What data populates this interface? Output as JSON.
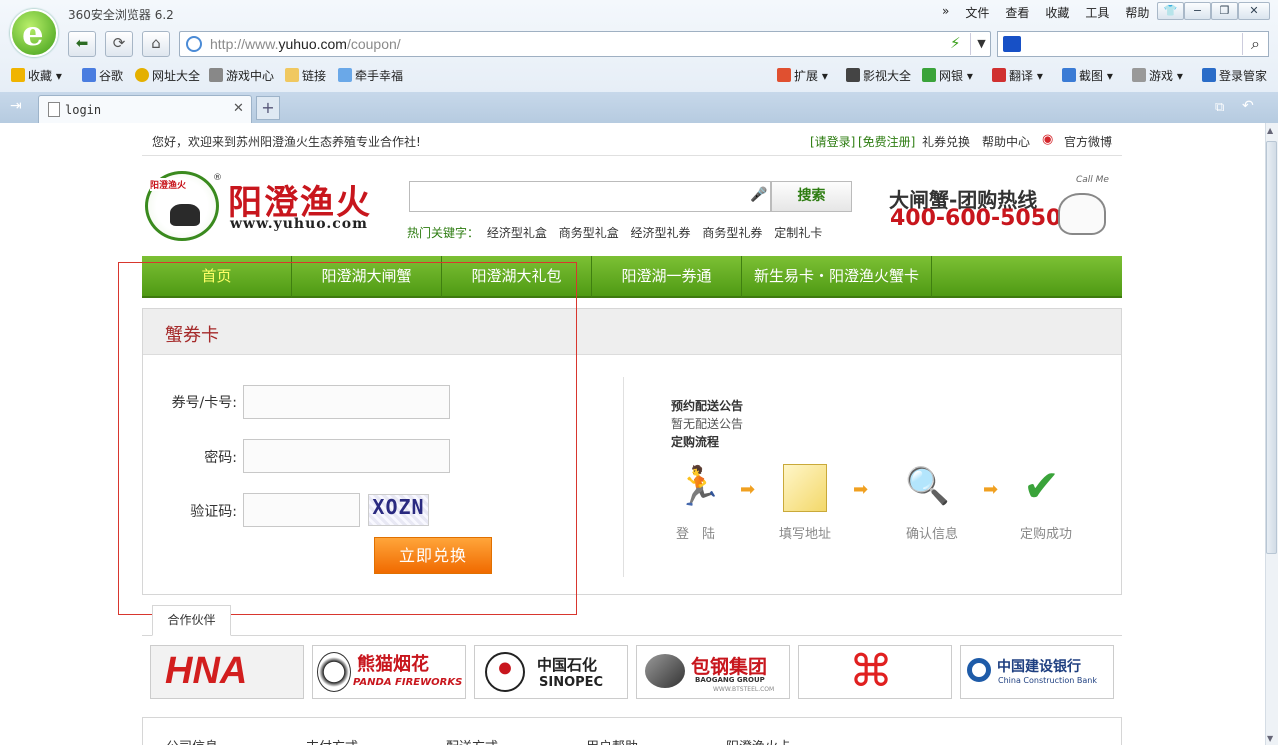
{
  "browser": {
    "title": "360安全浏览器 6.2",
    "menus": [
      "文件",
      "查看",
      "收藏",
      "工具",
      "帮助"
    ],
    "url_prefix": "http://www.",
    "url_domain": "yuhuo.com",
    "url_suffix": "/coupon/",
    "bookmarks": [
      {
        "label": "收藏",
        "icon": "star-icon"
      },
      {
        "label": "谷歌",
        "icon": "google-icon"
      },
      {
        "label": "网址大全",
        "icon": "globe-icon"
      },
      {
        "label": "游戏中心",
        "icon": "gamepad-icon"
      },
      {
        "label": "链接",
        "icon": "folder-icon"
      },
      {
        "label": "牵手幸福",
        "icon": "heart-icon"
      }
    ],
    "tools": [
      {
        "label": "扩展"
      },
      {
        "label": "影视大全"
      },
      {
        "label": "网银"
      },
      {
        "label": "翻译"
      },
      {
        "label": "截图"
      },
      {
        "label": "游戏"
      },
      {
        "label": "登录管家"
      }
    ],
    "tab_label": "login",
    "new_tab": "+"
  },
  "site": {
    "welcome": "您好，欢迎来到苏州阳澄渔火生态养殖专业合作社!",
    "login": "[请登录]",
    "register": "[免费注册]",
    "links": [
      "礼券兑换",
      "帮助中心",
      "官方微博"
    ],
    "brand": "阳澄渔火",
    "brand_url": "www.yuhuo.com",
    "brand_small": "阳澄渔火",
    "search_button": "搜索",
    "hot_label": "热门关键字：",
    "hot_keywords": [
      "经济型礼盒",
      "商务型礼盒",
      "经济型礼券",
      "商务型礼券",
      "定制礼卡"
    ],
    "hotline_title": "大闸蟹-团购热线",
    "hotline_number": "400-600-5050",
    "call_me": "Call Me",
    "nav": [
      "首页",
      "阳澄湖大闸蟹",
      "阳澄湖大礼包",
      "阳澄湖一券通",
      "新生易卡・阳澄渔火蟹卡"
    ],
    "panel_title": "蟹券卡",
    "card_label": "券号/卡号:",
    "password_label": "密码:",
    "captcha_label": "验证码:",
    "captcha_text": "XOZN",
    "submit": "立即兑换",
    "notice_title": "预约配送公告",
    "notice_text": "暂无配送公告",
    "process_title": "定购流程",
    "steps": [
      "登　陆",
      "填写地址",
      "确认信息",
      "定购成功"
    ],
    "partners_tab": "合作伙伴",
    "partners": [
      "HNA",
      "熊猫烟花",
      "PANDA FIREWORKS",
      "中国石化",
      "SINOPEC",
      "包钢集团",
      "BAOGANG GROUP",
      "WWW.BTSTEEL.COM",
      "中国建设银行",
      "China Construction Bank"
    ],
    "footer": [
      "公司信息",
      "支付方式",
      "配送方式",
      "用户帮助",
      "阳澄渔火卡"
    ]
  },
  "colors": {
    "green": "#5aa21a",
    "red": "#c8161d",
    "orange": "#f47b0b"
  }
}
